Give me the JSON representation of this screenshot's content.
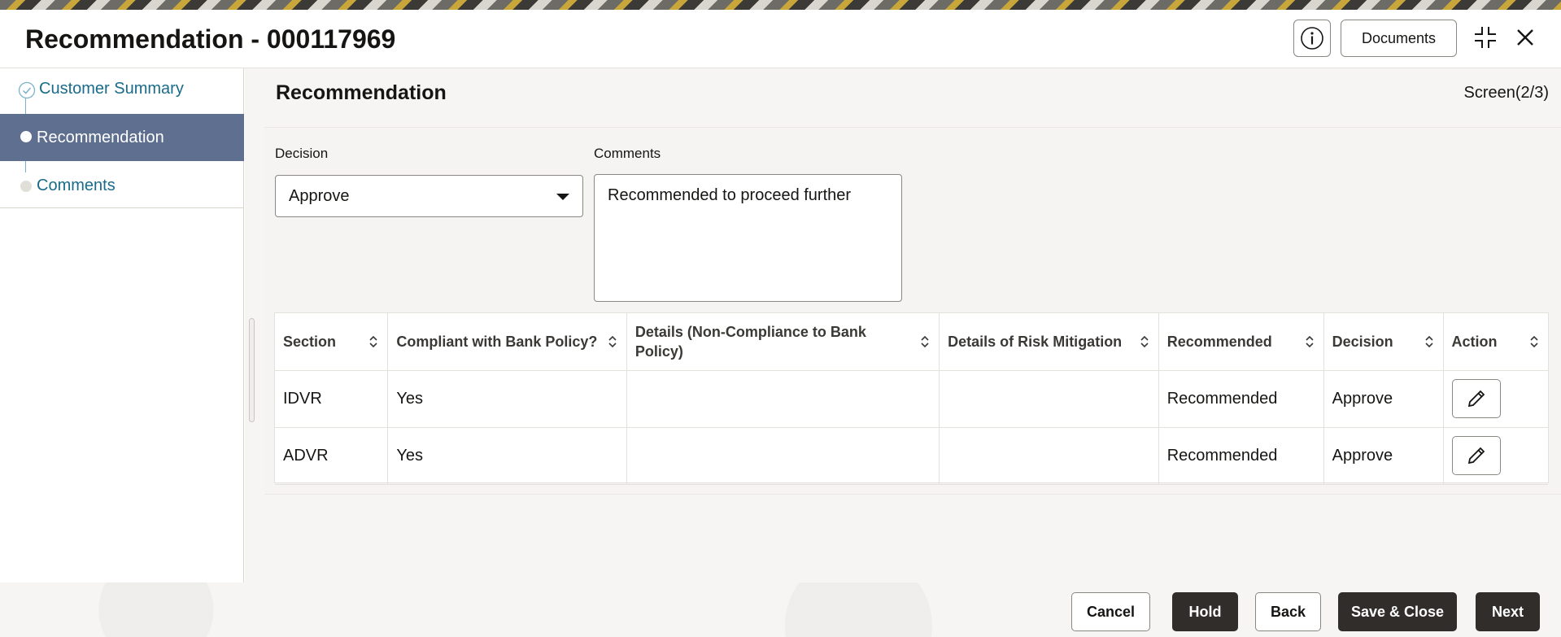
{
  "header": {
    "title": "Recommendation - 000117969",
    "documents_label": "Documents"
  },
  "sidebar": {
    "steps": [
      {
        "label": "Customer Summary",
        "state": "completed"
      },
      {
        "label": "Recommendation",
        "state": "active"
      },
      {
        "label": "Comments",
        "state": "pending"
      }
    ]
  },
  "main": {
    "section_title": "Recommendation",
    "screen_indicator": "Screen(2/3)",
    "decision": {
      "label": "Decision",
      "value": "Approve"
    },
    "comments": {
      "label": "Comments",
      "value": "Recommended to proceed further"
    },
    "table": {
      "columns": [
        "Section",
        "Compliant with Bank Policy?",
        "Details (Non-Compliance to Bank Policy)",
        "Details of Risk Mitigation",
        "Recommended",
        "Decision",
        "Action"
      ],
      "rows": [
        {
          "section": "IDVR",
          "compliant": "Yes",
          "non_compliance_details": "",
          "risk_mitigation": "",
          "recommended": "Recommended",
          "decision": "Approve"
        },
        {
          "section": "ADVR",
          "compliant": "Yes",
          "non_compliance_details": "",
          "risk_mitigation": "",
          "recommended": "Recommended",
          "decision": "Approve"
        }
      ]
    }
  },
  "footer": {
    "cancel": "Cancel",
    "hold": "Hold",
    "back": "Back",
    "save_close": "Save & Close",
    "next": "Next"
  },
  "icons": {
    "info": "info-icon",
    "minimize": "minimize-icon",
    "close": "close-icon",
    "completed_step": "check-circle-icon",
    "sort": "sort-icon",
    "edit": "pencil-icon"
  },
  "colors": {
    "active_step_bg": "#5f6f8f",
    "link_text": "#1a6b8a",
    "primary_button": "#312d2a"
  }
}
